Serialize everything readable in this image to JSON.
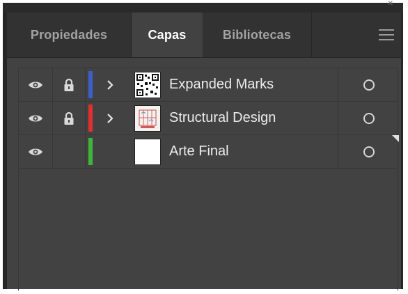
{
  "tabs": [
    {
      "label": "Propiedades",
      "active": false
    },
    {
      "label": "Capas",
      "active": true
    },
    {
      "label": "Bibliotecas",
      "active": false
    }
  ],
  "panel_menu_icon": "hamburger-menu-icon",
  "layers": [
    {
      "name": "Expanded Marks",
      "color": "#3a5fcd",
      "visible": true,
      "locked": true,
      "expandable": true,
      "thumbnail": "qr-code-thumbnail"
    },
    {
      "name": "Structural Design",
      "color": "#e0302f",
      "visible": true,
      "locked": true,
      "expandable": true,
      "thumbnail": "structural-design-thumbnail"
    },
    {
      "name": "Arte Final",
      "color": "#3fb63b",
      "visible": true,
      "locked": false,
      "expandable": false,
      "thumbnail": "blank-thumbnail",
      "selected_indicator": true
    }
  ],
  "colors": {
    "panel_bg": "#424242",
    "tabbar_bg": "#323232",
    "active_text": "#ffffff",
    "inactive_text": "#a3a3a3"
  }
}
